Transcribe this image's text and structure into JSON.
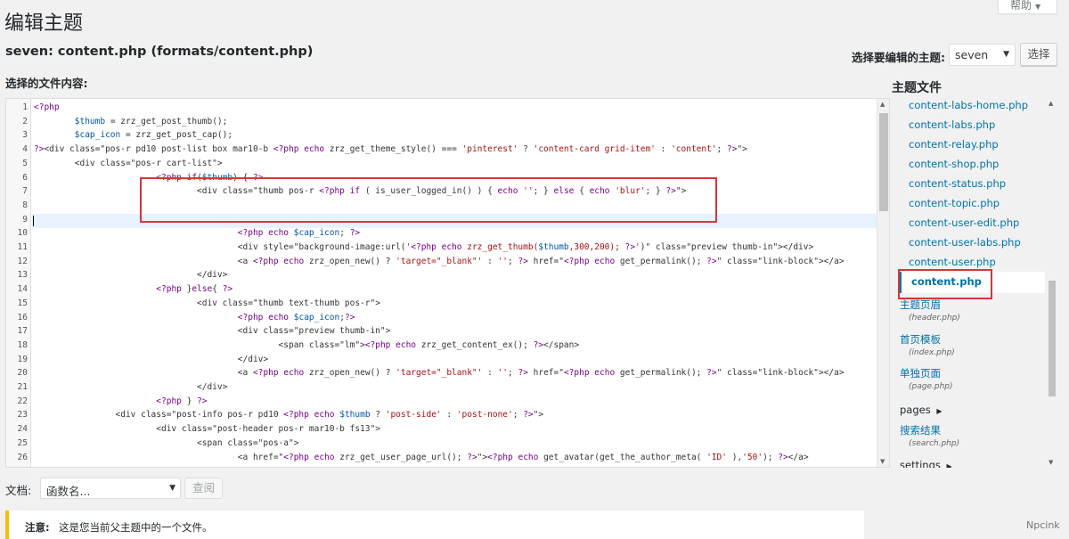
{
  "help_tab": {
    "label": "帮助",
    "arrow": "▼"
  },
  "page_title": "编辑主题",
  "file_heading": "seven: content.php (formats/content.php)",
  "file_content_label": "选择的文件内容:",
  "theme_selector": {
    "label": "选择要编辑的主题:",
    "selected": "seven",
    "button": "选择"
  },
  "editor": {
    "line_numbers": [
      "1",
      "2",
      "3",
      "4",
      "5",
      "6",
      "7",
      "8",
      "9",
      "10",
      "11",
      "12",
      "13",
      "14",
      "15",
      "16",
      "17",
      "18",
      "19",
      "20",
      "21",
      "22",
      "23",
      "24",
      "25",
      "26"
    ],
    "lines": [
      "<?php",
      "        $thumb = zrz_get_post_thumb();",
      "        $cap_icon = zrz_get_post_cap();",
      "?><div class=\"pos-r pd10 post-list box mar10-b <?php echo zrz_get_theme_style() === 'pinterest' ? 'content-card grid-item' : 'content'; ?>\">",
      "        <div class=\"pos-r cart-list\">",
      "                        <?php if($thumb) { ?>",
      "                                <div class=\"thumb pos-r <?php if ( is_user_logged_in() ) { echo ''; } else { echo 'blur'; } ?>\">",
      "",
      "",
      "                                        <?php echo $cap_icon; ?>",
      "                                        <div style=\"background-image:url('<?php echo zrz_get_thumb($thumb,300,200); ?>')\" class=\"preview thumb-in\"></div>",
      "                                        <a <?php echo zrz_open_new() ? 'target=\"_blank\"' : ''; ?> href=\"<?php echo get_permalink(); ?>\" class=\"link-block\"></a>",
      "                                </div>",
      "                        <?php }else{ ?>",
      "                                <div class=\"thumb text-thumb pos-r\">",
      "                                        <?php echo $cap_icon;?>",
      "                                        <div class=\"preview thumb-in\">",
      "                                                <span class=\"lm\"><?php echo zrz_get_content_ex(); ?></span>",
      "                                        </div>",
      "                                        <a <?php echo zrz_open_new() ? 'target=\"_blank\"' : ''; ?> href=\"<?php echo get_permalink(); ?>\" class=\"link-block\"></a>",
      "                                </div>",
      "                        <?php } ?>",
      "                <div class=\"post-info pos-r pd10 <?php echo $thumb ? 'post-side' : 'post-none'; ?>\">",
      "                        <div class=\"post-header pos-r mar10-b fs13\">",
      "                                <span class=\"pos-a\">",
      "                                        <a href=\"<?php echo zrz_get_user_page_url(); ?>\"><?php echo get_avatar(get_the_author_meta( 'ID' ),'50'); ?></a>"
    ]
  },
  "theme_files": {
    "title": "主题文件",
    "files": [
      "content-labs-home.php",
      "content-labs.php",
      "content-relay.php",
      "content-shop.php",
      "content-status.php",
      "content-topic.php",
      "content-user-edit.php",
      "content-user-labs.php",
      "content-user.php"
    ],
    "active_file": "content.php",
    "templates": [
      {
        "label": "主题页眉",
        "file": "(header.php)"
      },
      {
        "label": "首页模板",
        "file": "(index.php)"
      },
      {
        "label": "单独页面",
        "file": "(page.php)"
      }
    ],
    "folder_pages": "pages",
    "search_template": {
      "label": "搜索结果",
      "file": "(search.php)"
    },
    "folder_settings": "settings",
    "folder_arrow": "▶"
  },
  "documentation": {
    "label": "文档:",
    "select_placeholder": "函数名...",
    "button": "查阅"
  },
  "notice": {
    "strong": "注意:",
    "text": "这是您当前父主题中的一个文件。"
  },
  "watermark": "Npcink",
  "colors": {
    "link": "#0073aa",
    "highlight_box": "#d63638",
    "notice_border": "#ffb900",
    "active_line": "#e8f2ff"
  }
}
